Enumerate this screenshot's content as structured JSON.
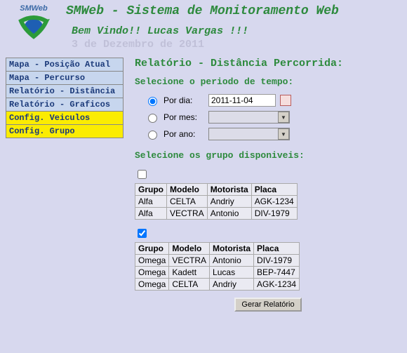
{
  "header": {
    "logo_label": "SMWeb",
    "app_title": "SMWeb - Sistema de Monitoramento Web",
    "welcome": "Bem Vindo!! Lucas Vargas !!!",
    "date": "3 de Dezembro de 2011"
  },
  "sidebar": {
    "items": [
      {
        "label": "Mapa - Posição Atual",
        "style": "nav-blue"
      },
      {
        "label": "Mapa - Percurso",
        "style": "nav-blue"
      },
      {
        "label": "Relatório - Distância",
        "style": "nav-blue"
      },
      {
        "label": "Relatório - Graficos",
        "style": "nav-blue"
      },
      {
        "label": "Config. Veiculos",
        "style": "nav-yellow"
      },
      {
        "label": "Config. Grupo",
        "style": "nav-yellow"
      }
    ]
  },
  "content": {
    "title": "Relatório - Distância Percorrida:",
    "period_label": "Selecione o periodo de tempo:",
    "periods": {
      "por_dia_label": "Por dia:",
      "por_dia_value": "2011-11-04",
      "por_mes_label": "Por mes:",
      "por_mes_value": "",
      "por_ano_label": "Por ano:",
      "por_ano_value": ""
    },
    "selected_period": "por_dia",
    "groups_label": "Selecione os grupo disponiveis:",
    "table_headers": [
      "Grupo",
      "Modelo",
      "Motorista",
      "Placa"
    ],
    "group1": {
      "checked": false,
      "rows": [
        [
          "Alfa",
          "CELTA",
          "Andriy",
          "AGK-1234"
        ],
        [
          "Alfa",
          "VECTRA",
          "Antonio",
          "DIV-1979"
        ]
      ]
    },
    "group2": {
      "checked": true,
      "rows": [
        [
          "Omega",
          "VECTRA",
          "Antonio",
          "DIV-1979"
        ],
        [
          "Omega",
          "Kadett",
          "Lucas",
          "BEP-7447"
        ],
        [
          "Omega",
          "CELTA",
          "Andriy",
          "AGK-1234"
        ]
      ]
    },
    "generate_button": "Gerar Relatório"
  }
}
